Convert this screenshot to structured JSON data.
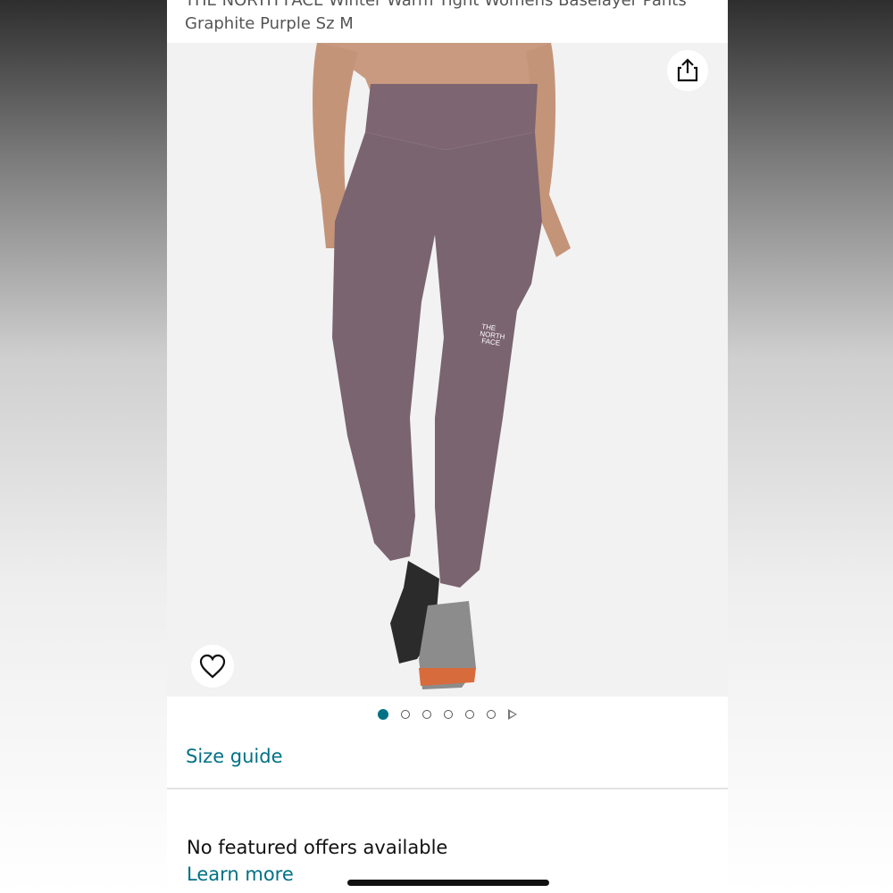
{
  "product": {
    "title": "THE NORTH FACE Winter Warm Tight Womens Baselayer Pants Graphite Purple Sz M",
    "brand_mark": "THE NORTH FACE"
  },
  "gallery": {
    "image_count": 6,
    "active_index": 0,
    "has_video": true
  },
  "links": {
    "size_guide": "Size guide",
    "learn_more": "Learn more"
  },
  "offers": {
    "status": "No featured offers available"
  },
  "colors": {
    "accent": "#007185",
    "leggings": "#7a6470"
  }
}
